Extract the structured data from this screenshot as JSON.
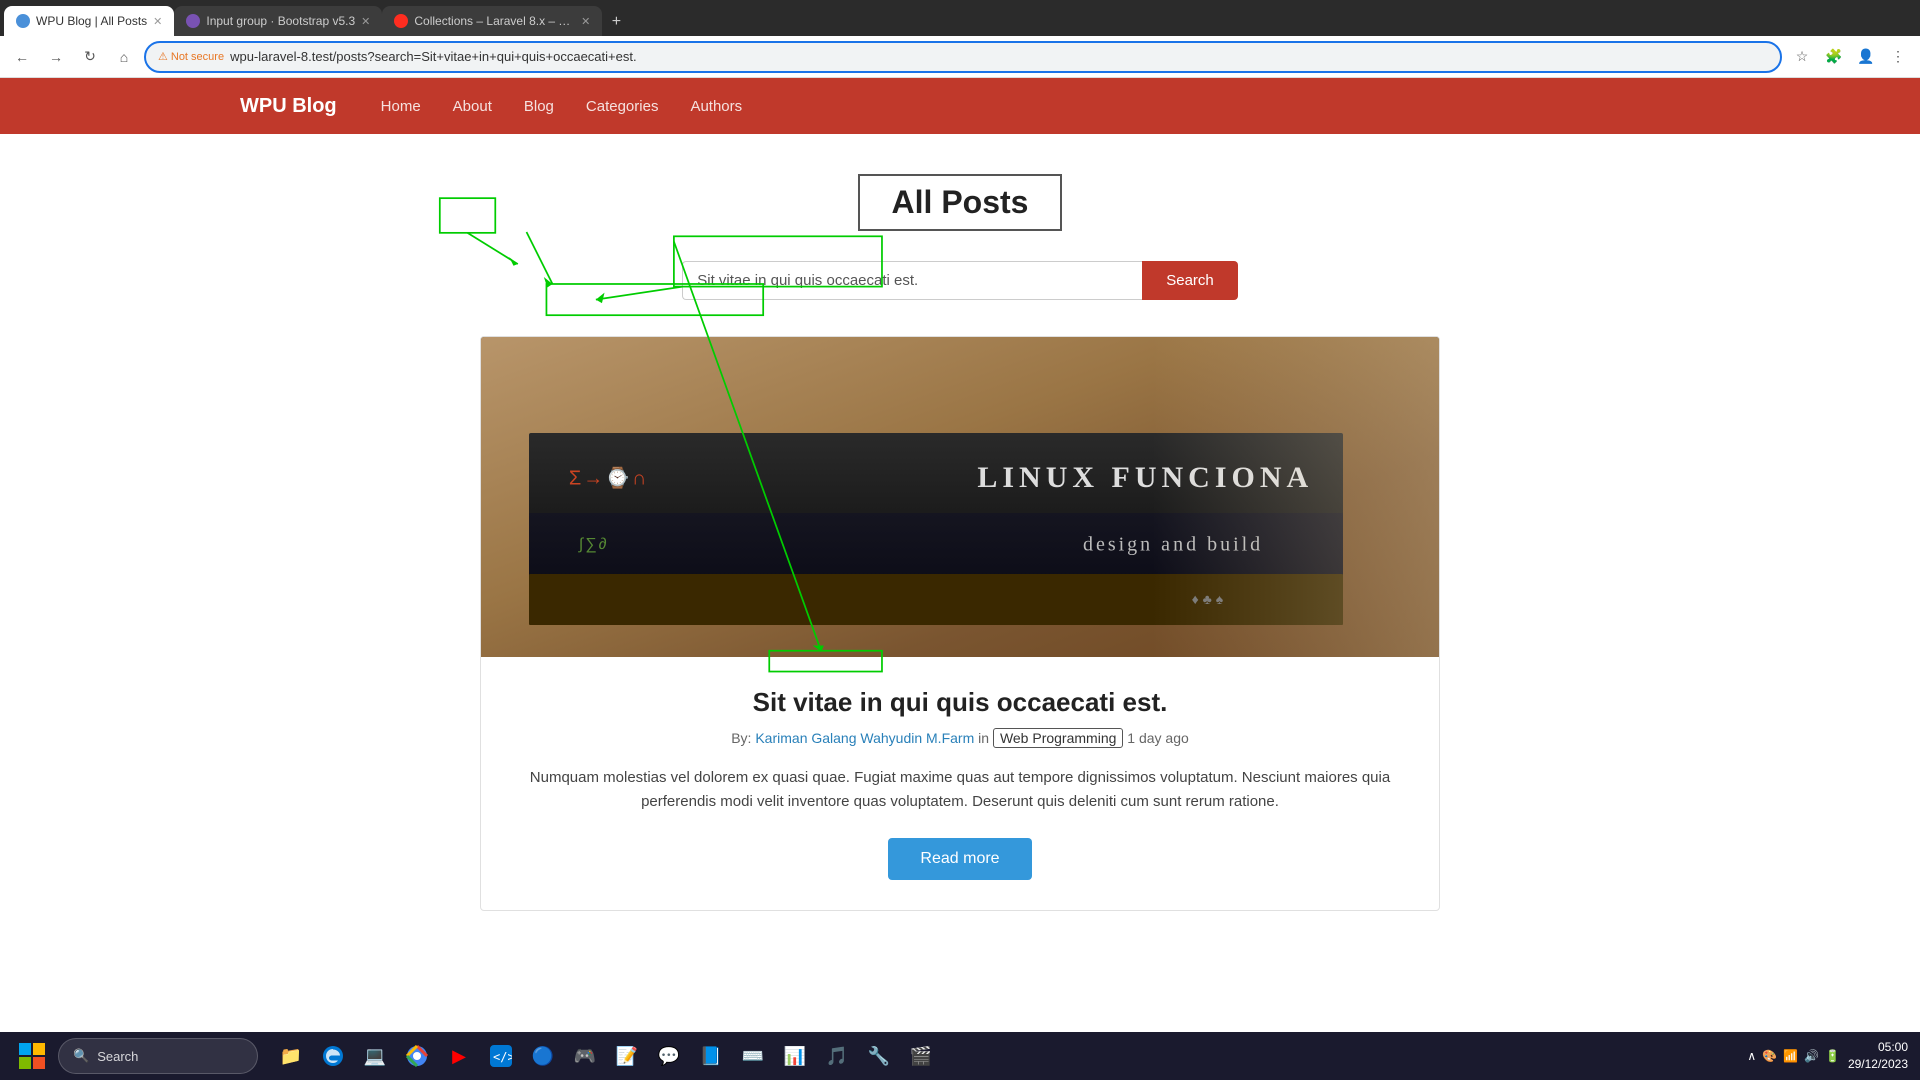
{
  "browser": {
    "tabs": [
      {
        "id": "tab1",
        "label": "WPU Blog | All Posts",
        "active": true,
        "icon_color": "#4a90d9"
      },
      {
        "id": "tab2",
        "label": "Input group · Bootstrap v5.3",
        "active": false,
        "icon_color": "#7952b3"
      },
      {
        "id": "tab3",
        "label": "Collections – Laravel 8.x – The F...",
        "active": false,
        "icon_color": "#ff2d20"
      }
    ],
    "address_bar": {
      "security_label": "Not secure",
      "url_base": "wpu-laravel-8.test",
      "url_path": "/posts?search=Sit+vitae+in+qui+quis+occaecati+est."
    }
  },
  "site": {
    "brand": "WPU Blog",
    "nav": [
      {
        "label": "Home",
        "href": "#"
      },
      {
        "label": "About",
        "href": "#",
        "annotated": true
      },
      {
        "label": "Blog",
        "href": "#"
      },
      {
        "label": "Categories",
        "href": "#"
      },
      {
        "label": "Authors",
        "href": "#"
      }
    ],
    "page_title": "All Posts",
    "search": {
      "placeholder": "Sit vitae in qui quis occaecati est.",
      "button_label": "Search"
    },
    "post": {
      "title": "Sit vitae in qui quis occaecati est.",
      "meta_prefix": "By:",
      "author": "Kariman Galang Wahyudin M.Farm",
      "meta_in": "in",
      "category": "Web Programming",
      "time_ago": "1 day ago",
      "excerpt": "Numquam molestias vel dolorem ex quasi quae. Fugiat maxime quas aut tempore dignissimos voluptatum. Nesciunt maiores quia perferendis modi velit inventore quas voluptatem. Deserunt quis deleniti cum sunt rerum ratione.",
      "read_more_label": "Read more",
      "image_texts": {
        "book_b": "LINUX FUNCIONA",
        "book_c": "design and build",
        "book_d": ""
      }
    }
  },
  "annotations": {
    "boxes": [
      {
        "id": "title-box",
        "label": "All Posts title box"
      },
      {
        "id": "about-box",
        "label": "About nav link box"
      },
      {
        "id": "search-input-box",
        "label": "Search input box"
      },
      {
        "id": "category-box",
        "label": "Category badge box"
      }
    ]
  },
  "taskbar": {
    "search_label": "Search",
    "clock": "05:00",
    "date": "29/12/2023",
    "apps": [
      "📁",
      "🖥️",
      "📂",
      "🌐",
      "▶️",
      "🔵",
      "🎮",
      "📝",
      "🟠",
      "💬",
      "📘",
      "💻",
      "📊",
      "🎵",
      "🔧"
    ]
  }
}
